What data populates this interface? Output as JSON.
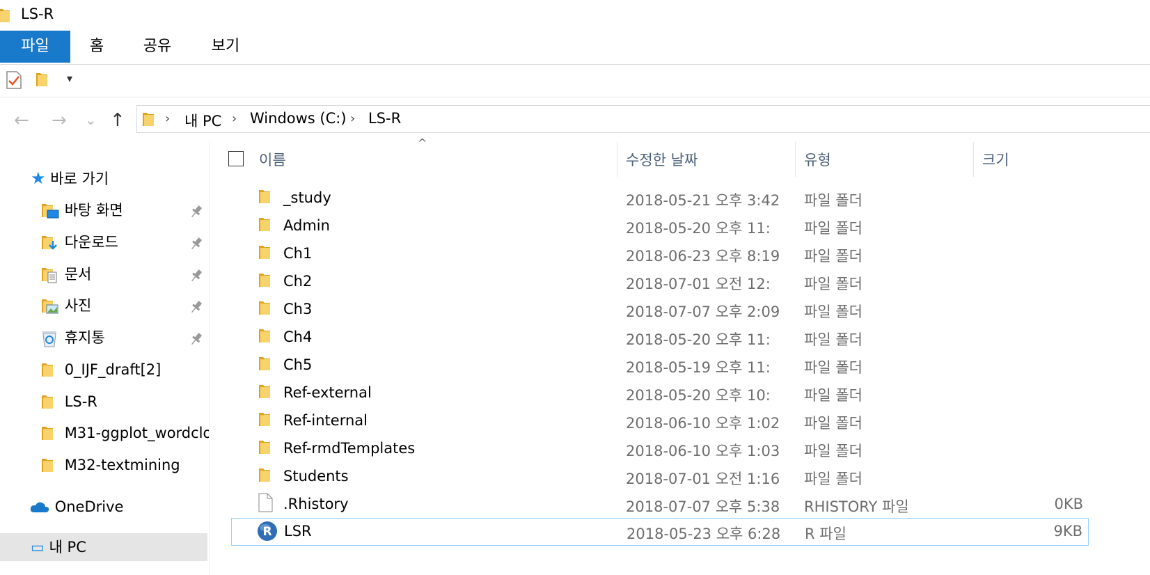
{
  "window": {
    "title": "LS-R"
  },
  "ribbon": {
    "tabs": [
      "파일",
      "홈",
      "공유",
      "보기"
    ]
  },
  "quick_access": {
    "dropdown_glyph": "▾"
  },
  "nav": {
    "back": "←",
    "forward": "→",
    "recent": "⌄",
    "up": "↑",
    "path": [
      "내 PC",
      "Windows (C:)",
      "LS-R"
    ]
  },
  "sidebar": {
    "quick_access_label": "바로 가기",
    "items": [
      {
        "label": "바탕 화면",
        "icon": "desktop-folder-icon",
        "pinned": true
      },
      {
        "label": "다운로드",
        "icon": "downloads-folder-icon",
        "pinned": true
      },
      {
        "label": "문서",
        "icon": "documents-folder-icon",
        "pinned": true
      },
      {
        "label": "사진",
        "icon": "pictures-folder-icon",
        "pinned": true
      },
      {
        "label": "휴지통",
        "icon": "recycle-bin-icon",
        "pinned": true
      },
      {
        "label": "0_IJF_draft[2]",
        "icon": "folder-icon",
        "pinned": false
      },
      {
        "label": "LS-R",
        "icon": "folder-icon",
        "pinned": false
      },
      {
        "label": "M31-ggplot_wordclo",
        "icon": "folder-icon",
        "pinned": false
      },
      {
        "label": "M32-textmining",
        "icon": "folder-icon",
        "pinned": false
      }
    ],
    "onedrive_label": "OneDrive",
    "thispc_label": "내 PC"
  },
  "list": {
    "columns": {
      "name": "이름",
      "date": "수정한 날짜",
      "type": "유형",
      "size": "크기"
    },
    "sort_glyph": "^",
    "rows": [
      {
        "name": "_study",
        "date": "2018-05-21 오후 3:42",
        "type": "파일 폴더",
        "size": "",
        "icon": "folder-icon"
      },
      {
        "name": "Admin",
        "date": "2018-05-20 오후 11:",
        "type": "파일 폴더",
        "size": "",
        "icon": "folder-icon"
      },
      {
        "name": "Ch1",
        "date": "2018-06-23 오후 8:19",
        "type": "파일 폴더",
        "size": "",
        "icon": "folder-icon"
      },
      {
        "name": "Ch2",
        "date": "2018-07-01 오전 12:",
        "type": "파일 폴더",
        "size": "",
        "icon": "folder-icon"
      },
      {
        "name": "Ch3",
        "date": "2018-07-07 오후 2:09",
        "type": "파일 폴더",
        "size": "",
        "icon": "folder-icon"
      },
      {
        "name": "Ch4",
        "date": "2018-05-20 오후 11:",
        "type": "파일 폴더",
        "size": "",
        "icon": "folder-icon"
      },
      {
        "name": "Ch5",
        "date": "2018-05-19 오후 11:",
        "type": "파일 폴더",
        "size": "",
        "icon": "folder-icon"
      },
      {
        "name": "Ref-external",
        "date": "2018-05-20 오후 10:",
        "type": "파일 폴더",
        "size": "",
        "icon": "folder-icon"
      },
      {
        "name": "Ref-internal",
        "date": "2018-06-10 오후 1:02",
        "type": "파일 폴더",
        "size": "",
        "icon": "folder-icon"
      },
      {
        "name": "Ref-rmdTemplates",
        "date": "2018-06-10 오후 1:03",
        "type": "파일 폴더",
        "size": "",
        "icon": "folder-icon"
      },
      {
        "name": "Students",
        "date": "2018-07-01 오전 1:16",
        "type": "파일 폴더",
        "size": "",
        "icon": "folder-icon"
      },
      {
        "name": ".Rhistory",
        "date": "2018-07-07 오후 5:38",
        "type": "RHISTORY 파일",
        "size": "0KB",
        "icon": "blank-file-icon"
      },
      {
        "name": "LSR",
        "date": "2018-05-23 오후 6:28",
        "type": "R 파일",
        "size": "9KB",
        "icon": "r-file-icon"
      }
    ]
  },
  "colors": {
    "accent": "#1979ca",
    "folder": "#f7c948",
    "selection_border": "#99d1ff"
  }
}
